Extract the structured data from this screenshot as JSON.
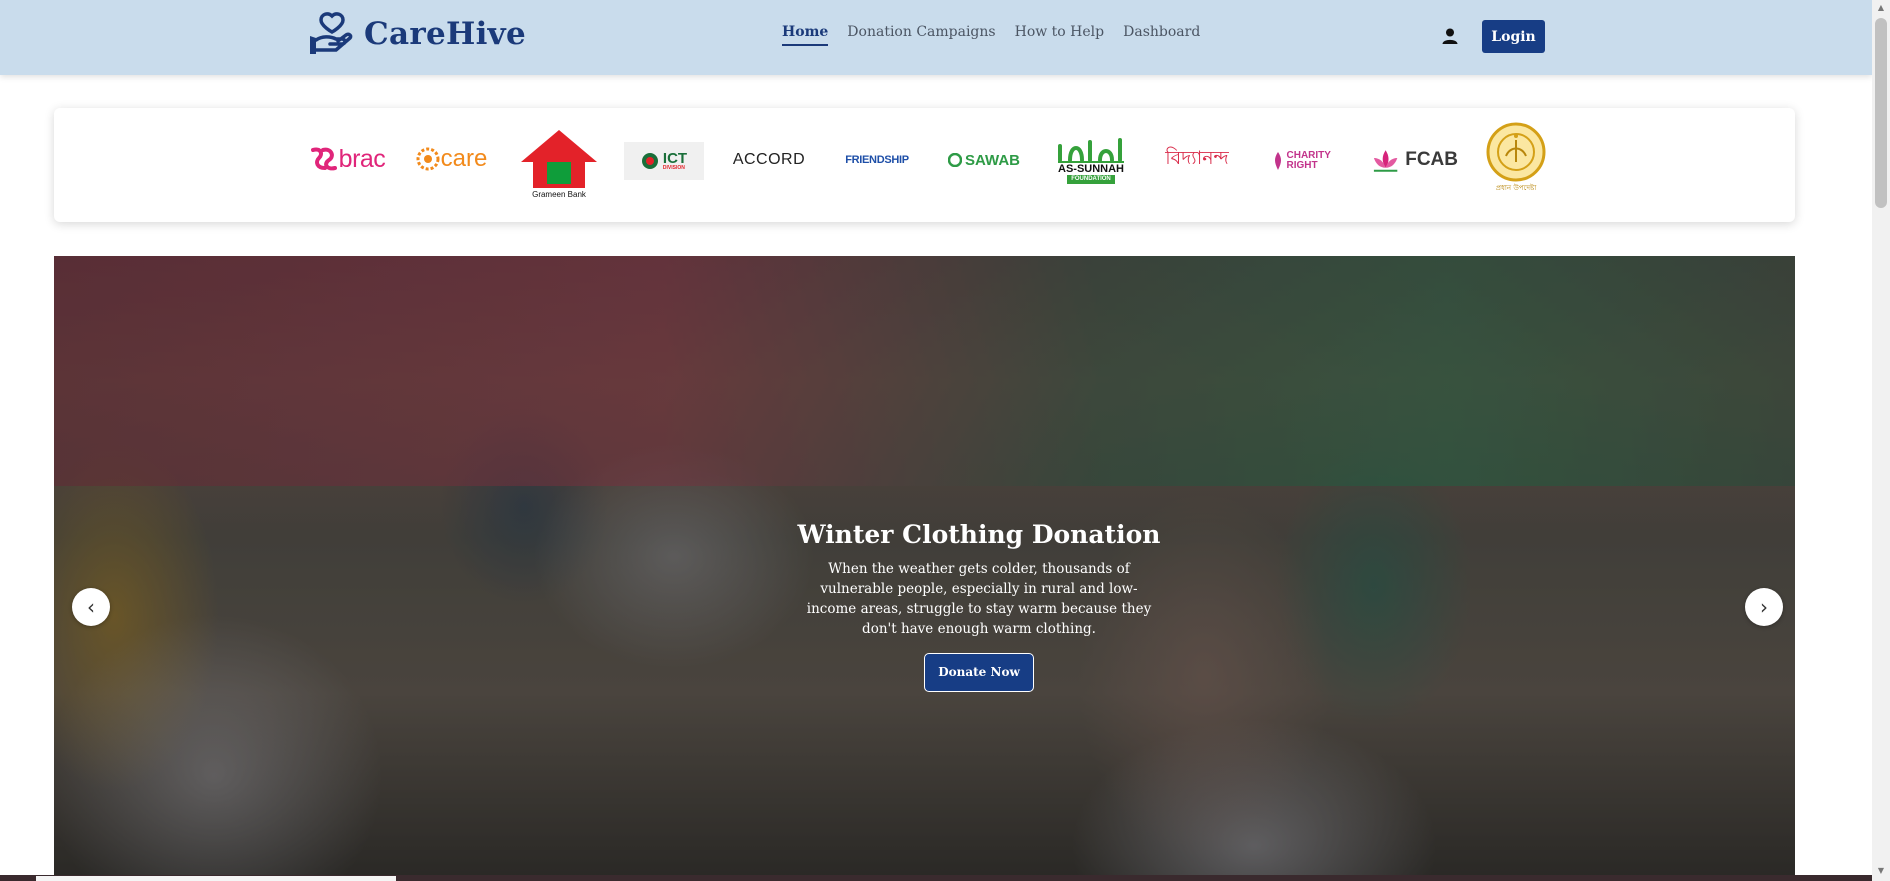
{
  "brand": {
    "name": "CareHive",
    "color": "#1b3a7a"
  },
  "nav": {
    "items": [
      {
        "label": "Home",
        "active": true
      },
      {
        "label": "Donation Campaigns",
        "active": false
      },
      {
        "label": "How to Help",
        "active": false
      },
      {
        "label": "Dashboard",
        "active": false
      }
    ],
    "user_icon": "user-icon",
    "login_label": "Login"
  },
  "partners": {
    "logos": [
      {
        "name": "brac",
        "text": "brac",
        "color": "#e0257a"
      },
      {
        "name": "care",
        "text": "care",
        "color": "#f28a1b"
      },
      {
        "name": "grameen-bank",
        "text": "Grameen Bank",
        "color": "#e32229"
      },
      {
        "name": "ict-division",
        "text": "ICT",
        "sub": "DIVISION",
        "color": "#1a6f3a"
      },
      {
        "name": "accord",
        "text": "ACCORD",
        "color": "#222222"
      },
      {
        "name": "friendship",
        "text": "FRIENDSHIP",
        "color": "#1e4fa8"
      },
      {
        "name": "sawab",
        "text": "SAWAB",
        "color": "#2e9b46"
      },
      {
        "name": "as-sunnah",
        "text": "AS-SUNNAH",
        "sub": "FOUNDATION",
        "color": "#35a13b"
      },
      {
        "name": "bidyanondo",
        "text": "বিদ্যানন্দ",
        "color": "#d92c4a"
      },
      {
        "name": "charity-right",
        "text": "CHARITY RIGHT",
        "color": "#c2338b"
      },
      {
        "name": "fcab",
        "text": "FCAB",
        "color": "#3a3a3a"
      },
      {
        "name": "gov-seal",
        "text": "প্রধান উপদেষ্টা",
        "color": "#d4a017"
      }
    ]
  },
  "hero": {
    "title": "Winter Clothing Donation",
    "description": "When the weather gets colder, thousands of vulnerable people, especially in rural and low-income areas, struggle to stay warm because they don't have enough warm clothing.",
    "button_label": "Donate Now",
    "prev_glyph": "‹",
    "next_glyph": "›"
  }
}
